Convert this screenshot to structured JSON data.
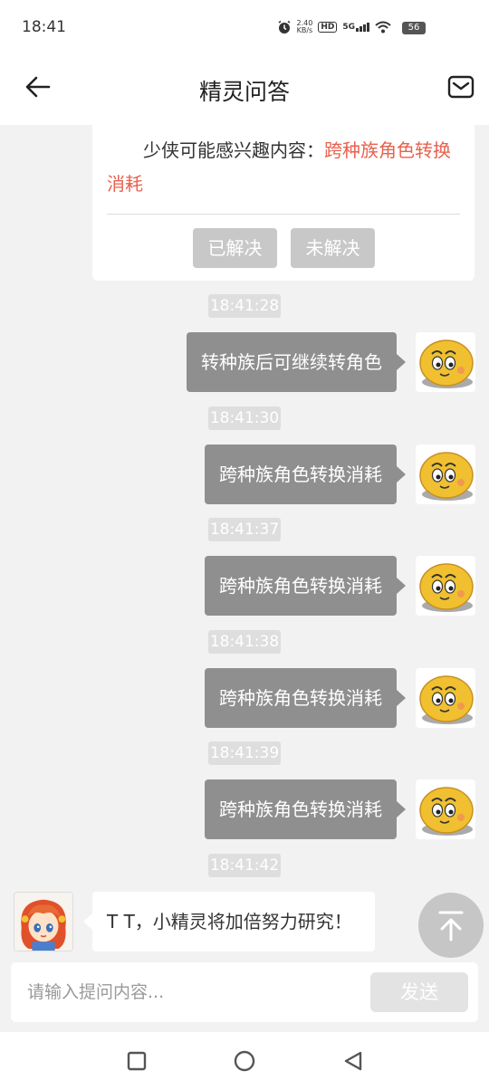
{
  "status_bar": {
    "time": "18:41",
    "net_speed_top": "2.40",
    "net_speed_bottom": "KB/s",
    "hd": "HD",
    "signal": "5G",
    "battery": "56",
    "icons": [
      "alarm-icon",
      "hd-icon",
      "signal-5g-icon",
      "wifi-icon",
      "battery-icon"
    ]
  },
  "header": {
    "title": "精灵问答",
    "back_icon": "arrow-left-icon",
    "mail_icon": "mail-icon"
  },
  "info_card": {
    "text_prefix": "少侠可能感兴趣内容：",
    "text_highlight": "跨种族角色转换消耗",
    "highlight_color": "#e8614d",
    "solved_label": "已解决",
    "unsolved_label": "未解决"
  },
  "messages": [
    {
      "time": "18:41:28",
      "text": "转种族后可继续转角色"
    },
    {
      "time": "18:41:30",
      "text": "跨种族角色转换消耗"
    },
    {
      "time": "18:41:37",
      "text": "跨种族角色转换消耗"
    },
    {
      "time": "18:41:38",
      "text": "跨种族角色转换消耗"
    },
    {
      "time": "18:41:39",
      "text": "跨种族角色转换消耗"
    }
  ],
  "reply": {
    "time": "18:41:42",
    "text": "T T，小精灵将加倍努力研究！"
  },
  "input": {
    "placeholder": "请输入提问内容...",
    "value": "",
    "send_label": "发送"
  },
  "nav": {
    "icons": [
      "square-recents-icon",
      "circle-home-icon",
      "triangle-back-icon"
    ]
  }
}
